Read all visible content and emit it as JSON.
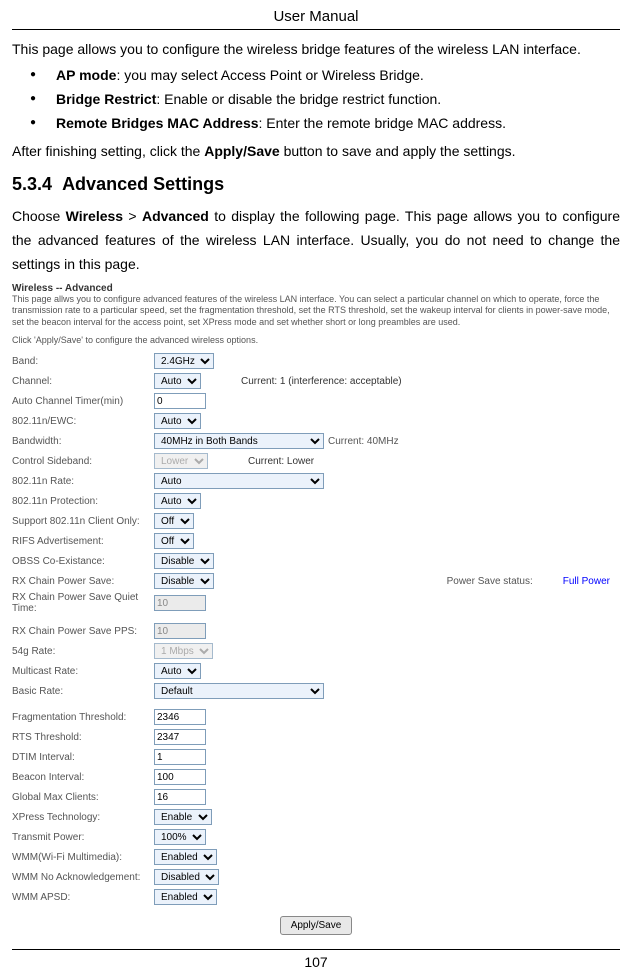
{
  "header": {
    "title": "User Manual"
  },
  "intro": "This page allows you to configure the wireless bridge features of the wireless LAN interface.",
  "bullets": [
    {
      "bold": "AP mode",
      "rest": ": you may select Access Point or Wireless Bridge."
    },
    {
      "bold": "Bridge Restrict",
      "rest": ": Enable or disable the bridge restrict function."
    },
    {
      "bold": "Remote Bridges MAC Address",
      "rest": ": Enter the remote bridge MAC address."
    }
  ],
  "after": {
    "pre": "After finishing setting, click the ",
    "bold": "Apply/Save",
    "post": " button to save and apply the settings."
  },
  "section": {
    "number": "5.3.4",
    "title": "Advanced Settings",
    "pre": "Choose ",
    "b1": "Wireless",
    "mid": " > ",
    "b2": "Advanced",
    "post": " to display the following page. This page allows you to configure the advanced features of the wireless LAN interface. Usually, you do not need to change the settings in this page."
  },
  "shot": {
    "heading": "Wireless -- Advanced",
    "desc": "This page allws you to configure advanced features of the wireless LAN interface. You can select a particular channel on which to operate, force the transmission rate to a particular speed, set the fragmentation threshold, set the RTS threshold, set the wakeup interval for clients in power-save mode, set the beacon interval for the access point, set XPress mode and set whether short or long preambles are used.",
    "desc2": "Click 'Apply/Save' to configure the advanced wireless options.",
    "rows": [
      {
        "label": "Band:",
        "type": "select",
        "value": "2.4GHz"
      },
      {
        "label": "Channel:",
        "type": "select",
        "value": "Auto",
        "extra": "Current: 1 (interference: acceptable)"
      },
      {
        "label": "Auto Channel Timer(min)",
        "type": "input",
        "value": "0"
      },
      {
        "label": "802.11n/EWC:",
        "type": "select",
        "value": "Auto"
      },
      {
        "label": "Bandwidth:",
        "type": "select",
        "value": "40MHz in Both Bands",
        "wide": true,
        "extra2": "Current: 40MHz"
      },
      {
        "label": "Control Sideband:",
        "type": "select",
        "value": "Lower",
        "disabled": true,
        "extra": "Current: Lower"
      },
      {
        "label": "802.11n Rate:",
        "type": "select",
        "value": "Auto",
        "wide": true
      },
      {
        "label": "802.11n Protection:",
        "type": "select",
        "value": "Auto"
      },
      {
        "label": "Support 802.11n Client Only:",
        "type": "select",
        "value": "Off"
      },
      {
        "label": "RIFS Advertisement:",
        "type": "select",
        "value": "Off"
      },
      {
        "label": "OBSS Co-Existance:",
        "type": "select",
        "value": "Disable"
      },
      {
        "label": "RX Chain Power Save:",
        "type": "select",
        "value": "Disable",
        "rightlabel": "Power Save status:",
        "rightval": "Full Power"
      },
      {
        "label": "RX Chain Power Save Quiet Time:",
        "type": "input",
        "value": "10",
        "disabled": true
      },
      {
        "label": "",
        "type": "spacer"
      },
      {
        "label": "RX Chain Power Save PPS:",
        "type": "input",
        "value": "10",
        "disabled": true
      },
      {
        "label": "54g Rate:",
        "type": "select",
        "value": "1 Mbps",
        "disabled": true
      },
      {
        "label": "Multicast Rate:",
        "type": "select",
        "value": "Auto"
      },
      {
        "label": "Basic Rate:",
        "type": "select",
        "value": "Default",
        "wide": true
      },
      {
        "label": "",
        "type": "spacer"
      },
      {
        "label": "Fragmentation Threshold:",
        "type": "input",
        "value": "2346"
      },
      {
        "label": "RTS Threshold:",
        "type": "input",
        "value": "2347"
      },
      {
        "label": "DTIM Interval:",
        "type": "input",
        "value": "1"
      },
      {
        "label": "Beacon Interval:",
        "type": "input",
        "value": "100"
      },
      {
        "label": "Global Max Clients:",
        "type": "input",
        "value": "16"
      },
      {
        "label": "XPress Technology:",
        "type": "select",
        "value": "Enable"
      },
      {
        "label": "Transmit Power:",
        "type": "select",
        "value": "100%"
      },
      {
        "label": "WMM(Wi-Fi Multimedia):",
        "type": "select",
        "value": "Enabled"
      },
      {
        "label": "WMM No Acknowledgement:",
        "type": "select",
        "value": "Disabled"
      },
      {
        "label": "WMM APSD:",
        "type": "select",
        "value": "Enabled"
      }
    ],
    "button": "Apply/Save"
  },
  "page_number": "107"
}
